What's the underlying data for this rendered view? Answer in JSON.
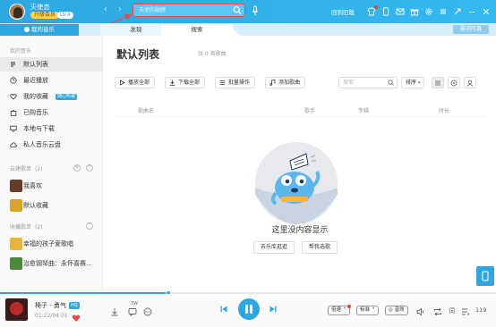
{
  "topbar": {
    "user_name": "天使恋",
    "vip_badge": "升级会员",
    "level_badge": "LV.4",
    "search_placeholder": "天使的翅膀",
    "back_link": "回到旧版",
    "accent_color": "#2ea7e0"
  },
  "tabs": {
    "my_music": "我的音乐",
    "discover": "发现",
    "search": "搜索",
    "lyrics_poster": "歌词写真"
  },
  "sidebar": {
    "section_my": "我的音乐",
    "items": [
      {
        "label": "默认列表",
        "icon": "playlist-icon"
      },
      {
        "label": "最近播放",
        "icon": "clock-icon"
      },
      {
        "label": "我的收藏",
        "icon": "heart-icon",
        "badge": "随心听歌"
      },
      {
        "label": "已购音乐",
        "icon": "bag-icon"
      },
      {
        "label": "本地与下载",
        "icon": "monitor-icon"
      },
      {
        "label": "私人音乐云盘",
        "icon": "cloud-icon"
      }
    ],
    "section_created": "自建歌单",
    "created_count": "(2)",
    "created": [
      {
        "label": "我喜欢"
      },
      {
        "label": "默认收藏"
      }
    ],
    "section_collected": "收藏歌单",
    "collected_count": "(2)",
    "collected": [
      {
        "label": "幸福的孩子爱歌唱"
      },
      {
        "label": "治愈钢琴曲：永怀喜赛…"
      }
    ]
  },
  "main": {
    "title": "默认列表",
    "count": "共 0 首歌曲",
    "actions": {
      "play_all": "播放全部",
      "download_all": "下载全部",
      "batch": "批量操作",
      "add_song": "添加歌曲"
    },
    "search_placeholder": "搜索",
    "sort_label": "排序",
    "columns": {
      "song": "歌曲名",
      "artist": "歌手",
      "album": "专辑",
      "duration": "时长"
    },
    "empty_text": "这里没内容显示",
    "empty_buttons": {
      "go_library": "去乐库逛逛",
      "help_pick": "帮我选歌"
    }
  },
  "player": {
    "song_title": "椅子 - 勇气",
    "quality_tag": "HQ",
    "time": "01:22/04:01",
    "progress": 0.34,
    "comment_count": "3W",
    "pills": {
      "quality": "标准",
      "speed": "倍速",
      "sound": "音效"
    },
    "lyrics_label": "词",
    "playlist_count": "119"
  }
}
